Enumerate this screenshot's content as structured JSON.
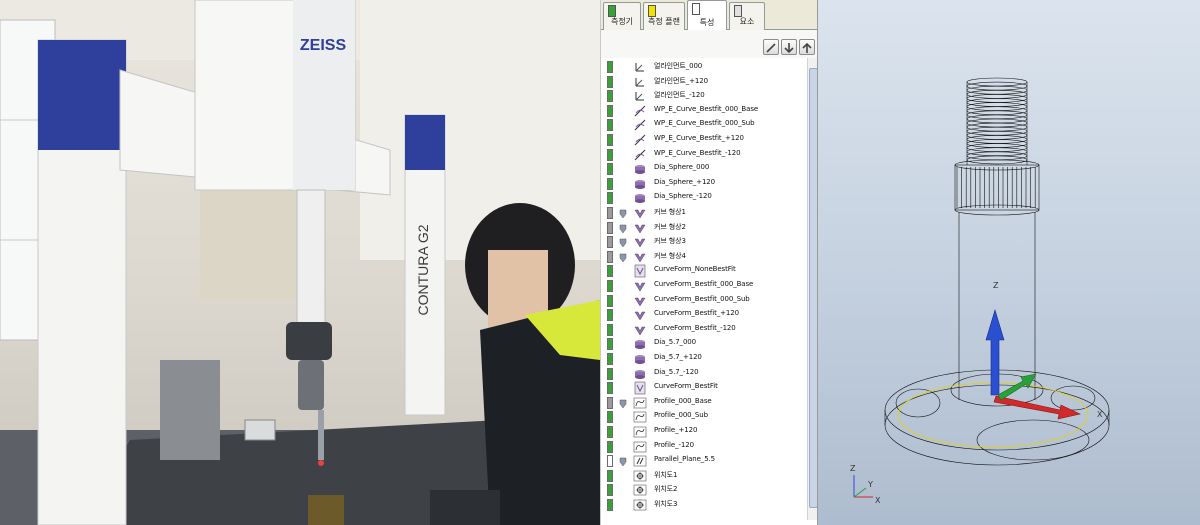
{
  "panel": {
    "tabs": [
      {
        "label": "측정기",
        "icon": "probe-icon",
        "color": "#3aa03a"
      },
      {
        "label": "측정 플랜",
        "icon": "plan-icon",
        "color": "#f2e200"
      },
      {
        "label": "특성",
        "icon": "characteristic-icon",
        "color": "#ffffff"
      },
      {
        "label": "요소",
        "icon": "element-icon",
        "color": "#e0e0e0"
      }
    ],
    "toolbar": {
      "edit_icon": "pencil-icon",
      "down_icon": "arrow-down-icon",
      "up_icon": "arrow-up-icon"
    },
    "items": [
      {
        "label": "얼라인먼트_000",
        "status": "green",
        "icon": "alignment-icon",
        "shield": false
      },
      {
        "label": "얼라인먼트_+120",
        "status": "green",
        "icon": "alignment-icon",
        "shield": false
      },
      {
        "label": "얼라인먼트_-120",
        "status": "green",
        "icon": "alignment-icon",
        "shield": false
      },
      {
        "label": "WP_E_Curve_Bestfit_000_Base",
        "status": "green",
        "icon": "curve-bestfit-icon",
        "shield": false
      },
      {
        "label": "WP_E_Curve_Bestfit_000_Sub",
        "status": "green",
        "icon": "curve-bestfit-icon",
        "shield": false
      },
      {
        "label": "WP_E_Curve_Bestfit_+120",
        "status": "green",
        "icon": "curve-bestfit-icon",
        "shield": false
      },
      {
        "label": "WP_E_Curve_Bestfit_-120",
        "status": "green",
        "icon": "curve-bestfit-icon",
        "shield": false
      },
      {
        "label": "Dia_Sphere_000",
        "status": "green",
        "icon": "sphere-icon",
        "shield": false
      },
      {
        "label": "Dia_Sphere_+120",
        "status": "green",
        "icon": "sphere-icon",
        "shield": false
      },
      {
        "label": "Dia_Sphere_-120",
        "status": "green",
        "icon": "sphere-icon",
        "shield": false
      },
      {
        "label": "커브 형상1",
        "status": "gray",
        "icon": "curve-form-icon",
        "shield": true
      },
      {
        "label": "커브 형상2",
        "status": "gray",
        "icon": "curve-form-icon",
        "shield": true
      },
      {
        "label": "커브 형상3",
        "status": "gray",
        "icon": "curve-form-icon",
        "shield": true
      },
      {
        "label": "커브 형상4",
        "status": "gray",
        "icon": "curve-form-icon",
        "shield": true
      },
      {
        "label": "CurveForm_NoneBestFit",
        "status": "green",
        "icon": "curve-form-doc-icon",
        "shield": false
      },
      {
        "label": "CurveForm_Bestfit_000_Base",
        "status": "green",
        "icon": "curve-form-icon",
        "shield": false
      },
      {
        "label": "CurveForm_Bestfit_000_Sub",
        "status": "green",
        "icon": "curve-form-icon",
        "shield": false
      },
      {
        "label": "CurveForm_Bestfit_+120",
        "status": "green",
        "icon": "curve-form-icon",
        "shield": false
      },
      {
        "label": "CurveForm_Bestfit_-120",
        "status": "green",
        "icon": "curve-form-icon",
        "shield": false
      },
      {
        "label": "Dia_5.7_000",
        "status": "green",
        "icon": "cylinder-icon",
        "shield": false
      },
      {
        "label": "Dia_5.7_+120",
        "status": "green",
        "icon": "cylinder-icon",
        "shield": false
      },
      {
        "label": "Dia_5.7_-120",
        "status": "green",
        "icon": "cylinder-icon",
        "shield": false
      },
      {
        "label": "CurveForm_BestFit",
        "status": "green",
        "icon": "curve-form-doc-icon",
        "shield": false
      },
      {
        "label": "Profile_000_Base",
        "status": "gray",
        "icon": "profile-icon",
        "shield": true
      },
      {
        "label": "Profile_000_Sub",
        "status": "green",
        "icon": "profile-icon",
        "shield": false
      },
      {
        "label": "Profile_+120",
        "status": "green",
        "icon": "profile-icon",
        "shield": false
      },
      {
        "label": "Profile_-120",
        "status": "green",
        "icon": "profile-icon",
        "shield": false
      },
      {
        "label": "Parallel_Plane_5.5",
        "status": "white",
        "icon": "parallelism-icon",
        "shield": true
      },
      {
        "label": "위치도1",
        "status": "green",
        "icon": "position-icon",
        "shield": false
      },
      {
        "label": "위치도2",
        "status": "green",
        "icon": "position-icon",
        "shield": false
      },
      {
        "label": "위치도3",
        "status": "green",
        "icon": "position-icon",
        "shield": false
      }
    ],
    "colors": {
      "green": "#3aa03a",
      "gray": "#9c9c9c",
      "white": "#ffffff"
    }
  },
  "photo": {
    "brand": "ZEISS",
    "model": "CONTURA G2"
  },
  "cad": {
    "axis_main": {
      "z": "Z",
      "x": "X"
    },
    "axis_corner": {
      "z": "Z",
      "y": "Y",
      "x": "X"
    },
    "colors": {
      "z_arrow": "#2a4fd1",
      "x_arrow": "#d12a2a",
      "y_arrow": "#2aa03a",
      "curve": "#e8d000"
    }
  }
}
